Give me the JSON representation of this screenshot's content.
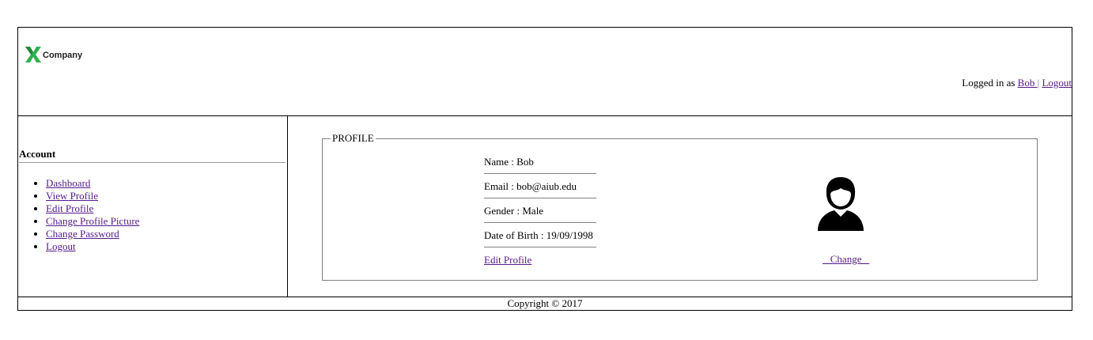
{
  "header": {
    "logo_text": "Company",
    "logged_in_prefix": "Logged in as ",
    "user_link": "Bob ",
    "separator": "|",
    "logout_link": "Logout"
  },
  "sidebar": {
    "title": "Account",
    "items": [
      {
        "label": "Dashboard"
      },
      {
        "label": "View Profile"
      },
      {
        "label": "Edit Profile"
      },
      {
        "label": "Change Profile Picture"
      },
      {
        "label": "Change Password"
      },
      {
        "label": "Logout"
      }
    ]
  },
  "profile": {
    "legend": "PROFILE",
    "name": "Name : Bob",
    "email": "Email : bob@aiub.edu",
    "gender": "Gender : Male",
    "dob": "Date of Birth : 19/09/1998",
    "edit_link": "Edit Profile",
    "change_link": "   Change   "
  },
  "footer": {
    "copyright": "Copyright © 2017"
  },
  "colors": {
    "link": "#551a8b",
    "logo_green": "#2bb24c"
  }
}
